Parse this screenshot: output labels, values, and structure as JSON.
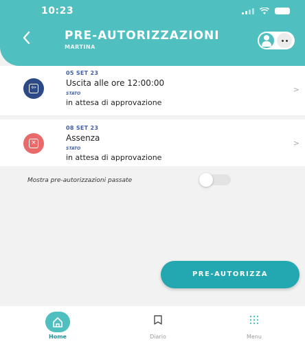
{
  "status_bar": {
    "time": "10:23"
  },
  "header": {
    "title": "PRE-AUTORIZZAZIONI",
    "subtitle": "MARTINA",
    "back_icon": "chevron-left-icon"
  },
  "items": [
    {
      "date": "05 SET 23",
      "type": "Uscita alle ore 12:00:00",
      "stato_label": "STATO",
      "status": "in attesa di approvazione",
      "icon": "exit-icon",
      "icon_color": "#2e4a86"
    },
    {
      "date": "08 SET 23",
      "type": "Assenza",
      "stato_label": "STATO",
      "status": "in attesa di approvazione",
      "icon": "absence-icon",
      "icon_color": "#e86a6a"
    }
  ],
  "toggle": {
    "label": "Mostra pre-autorizzazioni passate",
    "on": false
  },
  "fab": {
    "label": "PRE-AUTORIZZA"
  },
  "tabbar": {
    "home": "Home",
    "diario": "Diario",
    "menu": "Menu"
  },
  "colors": {
    "accent": "#4fbfc0",
    "fab": "#23a7b0",
    "date_blue": "#3e5fa8"
  }
}
